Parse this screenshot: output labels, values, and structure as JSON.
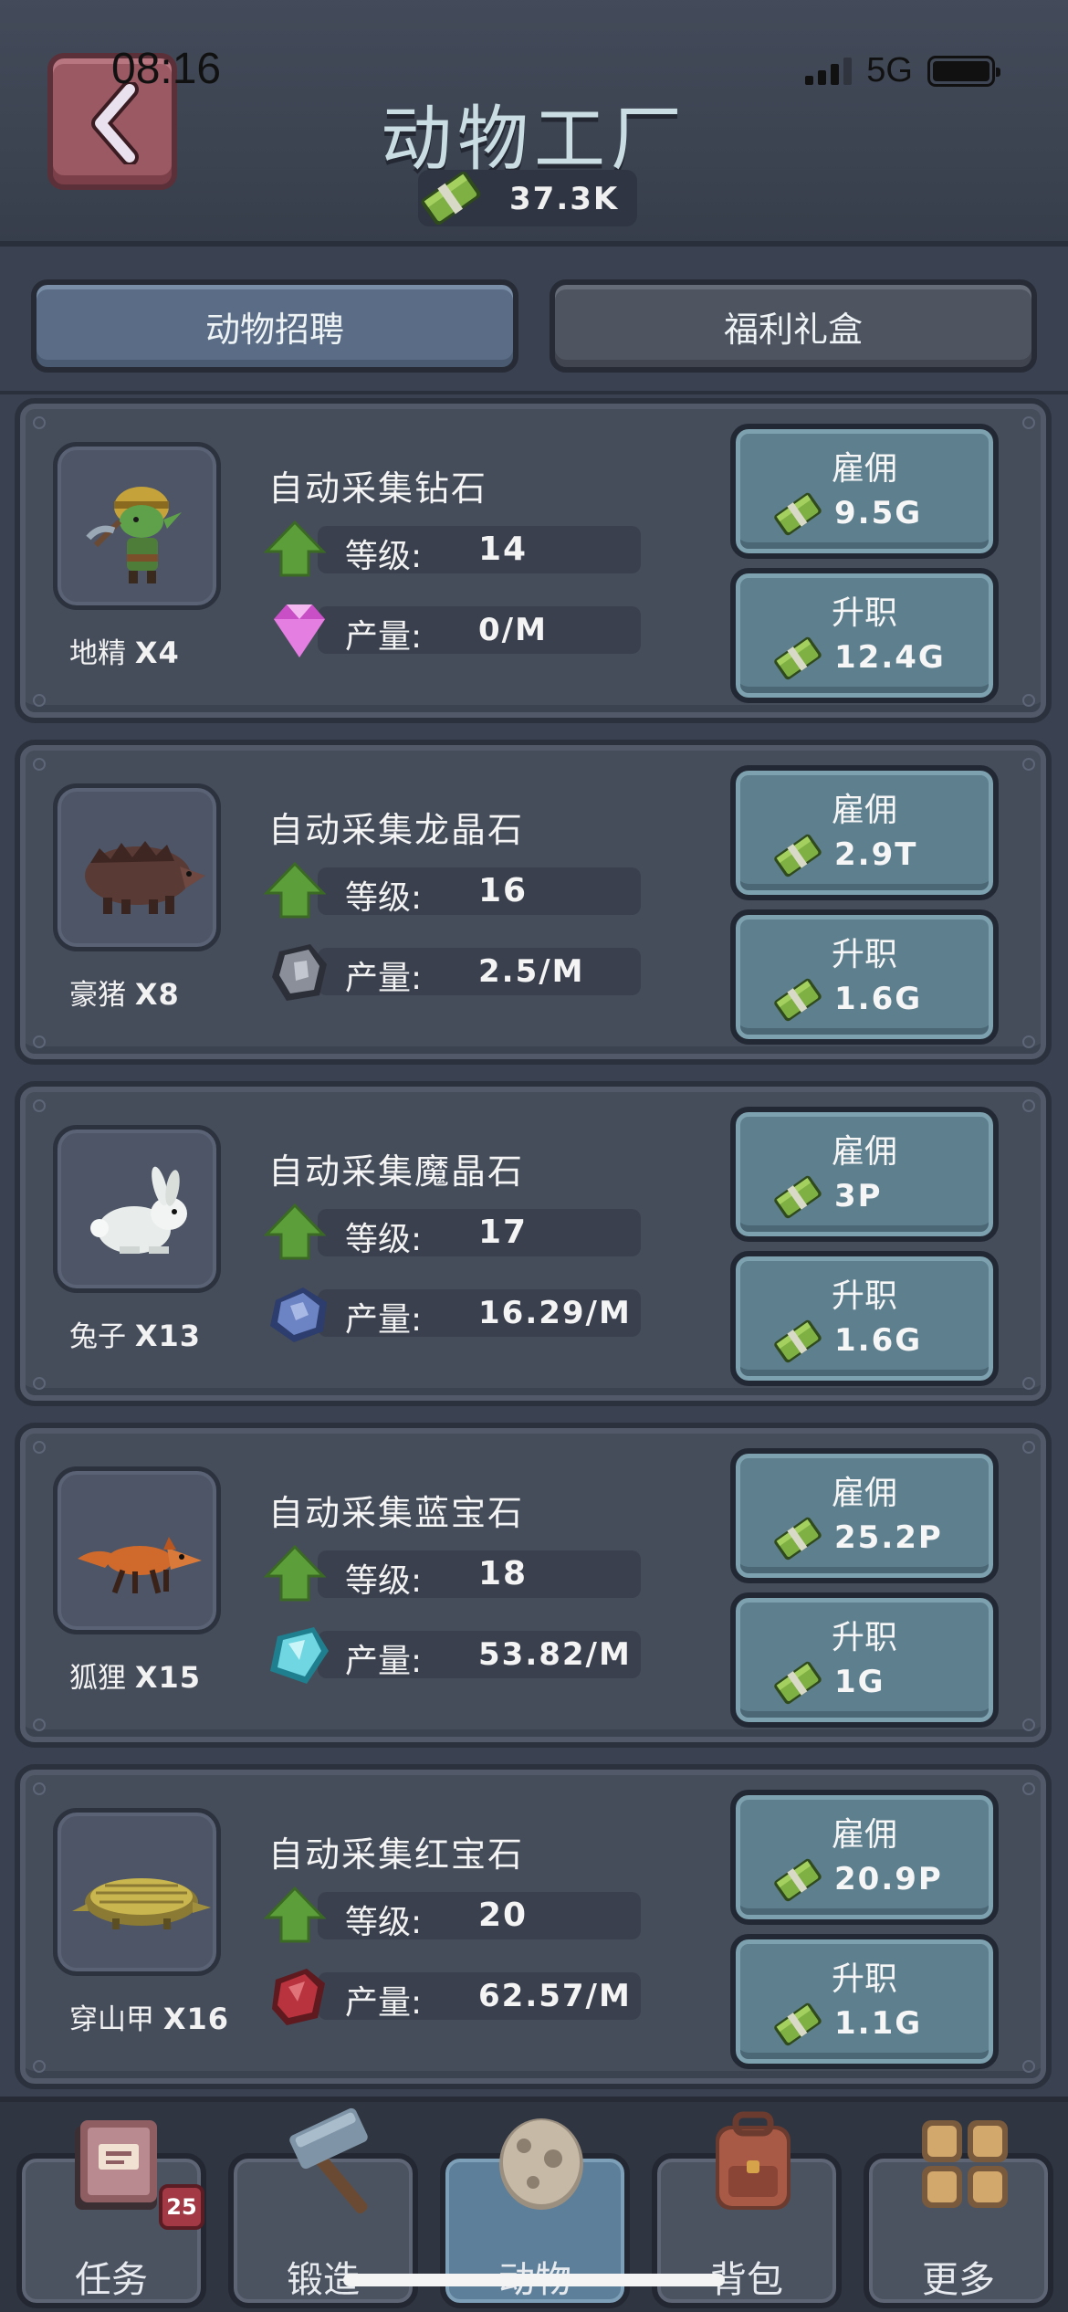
{
  "status_bar": {
    "time": "08:16",
    "network": "5G"
  },
  "header": {
    "title": "动物工厂",
    "currency": "37.3K"
  },
  "tabs": [
    {
      "label": "动物招聘",
      "active": true
    },
    {
      "label": "福利礼盒",
      "active": false
    }
  ],
  "animals": [
    {
      "name": "地精",
      "count": "X4",
      "job": "自动采集钻石",
      "level_label": "等级:",
      "level": "14",
      "output_label": "产量:",
      "output": "0/M",
      "hire_label": "雇佣",
      "hire_cost": "9.5G",
      "promote_label": "升职",
      "promote_cost": "12.4G",
      "resource_icon": "diamond-icon",
      "animal_icon": "goblin-icon"
    },
    {
      "name": "豪猪",
      "count": "X8",
      "job": "自动采集龙晶石",
      "level_label": "等级:",
      "level": "16",
      "output_label": "产量:",
      "output": "2.5/M",
      "hire_label": "雇佣",
      "hire_cost": "2.9T",
      "promote_label": "升职",
      "promote_cost": "1.6G",
      "resource_icon": "dragon-crystal-icon",
      "animal_icon": "porcupine-icon"
    },
    {
      "name": "兔子",
      "count": "X13",
      "job": "自动采集魔晶石",
      "level_label": "等级:",
      "level": "17",
      "output_label": "产量:",
      "output": "16.29/M",
      "hire_label": "雇佣",
      "hire_cost": "3P",
      "promote_label": "升职",
      "promote_cost": "1.6G",
      "resource_icon": "magic-crystal-icon",
      "animal_icon": "rabbit-icon"
    },
    {
      "name": "狐狸",
      "count": "X15",
      "job": "自动采集蓝宝石",
      "level_label": "等级:",
      "level": "18",
      "output_label": "产量:",
      "output": "53.82/M",
      "hire_label": "雇佣",
      "hire_cost": "25.2P",
      "promote_label": "升职",
      "promote_cost": "1G",
      "resource_icon": "sapphire-icon",
      "animal_icon": "fox-icon"
    },
    {
      "name": "穿山甲",
      "count": "X16",
      "job": "自动采集红宝石",
      "level_label": "等级:",
      "level": "20",
      "output_label": "产量:",
      "output": "62.57/M",
      "hire_label": "雇佣",
      "hire_cost": "20.9P",
      "promote_label": "升职",
      "promote_cost": "1.1G",
      "resource_icon": "ruby-icon",
      "animal_icon": "pangolin-icon"
    }
  ],
  "nav": [
    {
      "label": "任务",
      "icon": "quest-book-icon",
      "badge": "25",
      "active": false
    },
    {
      "label": "锻造",
      "icon": "hammer-icon",
      "active": false
    },
    {
      "label": "动物",
      "icon": "egg-icon",
      "active": true
    },
    {
      "label": "背包",
      "icon": "backpack-icon",
      "active": false
    },
    {
      "label": "更多",
      "icon": "grid-icon",
      "active": false
    }
  ],
  "colors": {
    "background": "#3a4150",
    "button": "#5e7f8e",
    "active_tab": "#5b6d86",
    "level_arrow": "#5c9e3a"
  }
}
